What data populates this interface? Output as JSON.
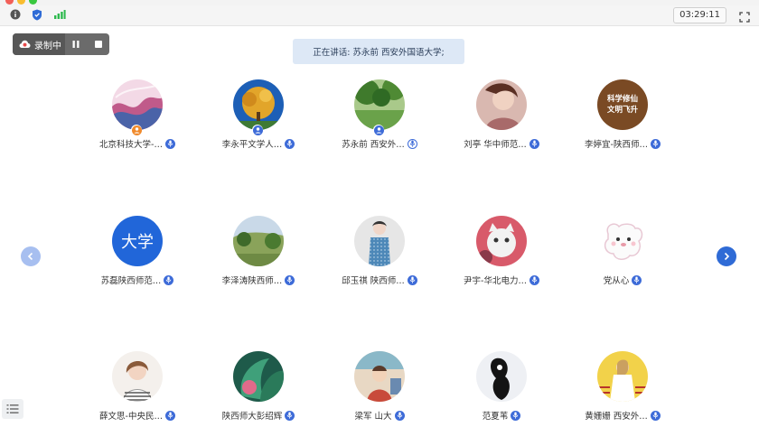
{
  "toolbar": {
    "info_icon": "info-icon",
    "shield_icon": "shield-icon",
    "signal_icon": "signal-bars-icon",
    "timer": "03:29:11",
    "fullscreen_icon": "fullscreen-icon"
  },
  "recording": {
    "label": "录制中",
    "pause_icon": "pause-icon",
    "stop_icon": "stop-icon"
  },
  "speaking": {
    "text": "正在讲话: 苏永前 西安外国语大学;"
  },
  "participants": [
    {
      "name": "北京科技大学-…",
      "badge": "host"
    },
    {
      "name": "李永平文学人…",
      "badge": "cohost"
    },
    {
      "name": "苏永前 西安外…",
      "badge": "cohost",
      "speaking": true
    },
    {
      "name": "刘亭 华中师范…"
    },
    {
      "name": "李婷宜-陕西师…",
      "avatar_text": "科学修仙 文明飞升"
    },
    {
      "name": "苏磊陕西师范…",
      "avatar_text": "大学"
    },
    {
      "name": "李泽涛陕西师…"
    },
    {
      "name": "邱玉祺 陕西师…"
    },
    {
      "name": "尹宇-华北电力…"
    },
    {
      "name": "党从心"
    },
    {
      "name": "薛文思-中央民…"
    },
    {
      "name": "陕西师大彭绍辉"
    },
    {
      "name": "梁军 山大"
    },
    {
      "name": "范夏苇"
    },
    {
      "name": "黄姗姗 西安外…"
    }
  ],
  "colors": {
    "accent": "#3d6bd8",
    "recording_red": "#e84a4a",
    "badge_orange": "#f08a2c",
    "speaking_bg": "#dde8f6"
  }
}
